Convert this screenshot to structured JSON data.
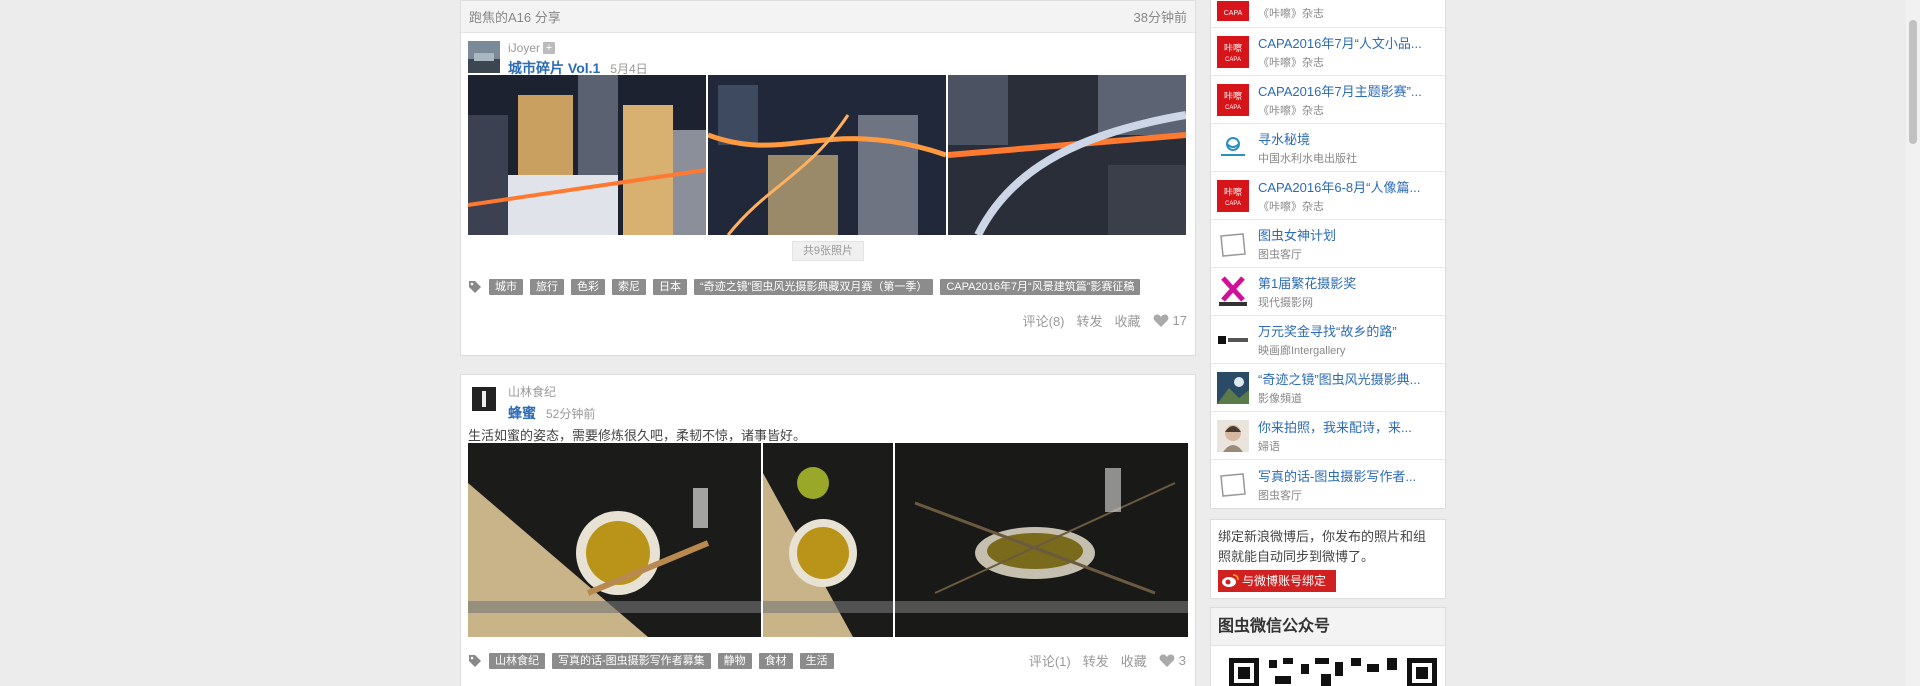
{
  "feed": {
    "post1": {
      "header_left": "跑焦的A16 分享",
      "header_right": "38分钟前",
      "author": "iJoyer",
      "title": "城市碎片 Vol.1",
      "date": "5月4日",
      "more_photos": "共9张照片",
      "tags": [
        "城市",
        "旅行",
        "色彩",
        "索尼",
        "日本",
        "“奇迹之镜”图虫风光摄影典藏双月赛（第一季）",
        "CAPA2016年7月“风景建筑篇”影赛征稿"
      ],
      "comments": "评论(8)",
      "repost": "转发",
      "favorite": "收藏",
      "likes": "17"
    },
    "post2": {
      "author": "山林食纪",
      "title": "蜂蜜",
      "date": "52分钟前",
      "description": "生活如蜜的姿态，需要修炼很久吧，柔韧不惊，诸事皆好。",
      "tags": [
        "山林食纪",
        "写真的话-图虫摄影写作者募集",
        "静物",
        "食材",
        "生活"
      ],
      "comments": "评论(1)",
      "repost": "转发",
      "favorite": "收藏",
      "likes": "3"
    }
  },
  "sidebar": {
    "events": [
      {
        "title": "",
        "sub": "《咔嚓》杂志",
        "logo": "capa-logo"
      },
      {
        "title": "CAPA2016年7月“人文小品...",
        "sub": "《咔嚓》杂志",
        "logo": "capa-logo"
      },
      {
        "title": "CAPA2016年7月主题影赛”...",
        "sub": "《咔嚓》杂志",
        "logo": "capa-logo"
      },
      {
        "title": "寻水秘境",
        "sub": "中国水利水电出版社",
        "logo": "waterpress-logo"
      },
      {
        "title": "CAPA2016年6-8月“人像篇...",
        "sub": "《咔嚓》杂志",
        "logo": "capa-logo"
      },
      {
        "title": "图虫女神计划",
        "sub": "图虫客厅",
        "logo": "placeholder-logo"
      },
      {
        "title": "第1届繁花摄影奖",
        "sub": "现代摄影网",
        "logo": "modern-photo-logo"
      },
      {
        "title": "万元奖金寻找“故乡的路”",
        "sub": "映画廊Intergallery",
        "logo": "intergallery-logo"
      },
      {
        "title": "“奇迹之镜”图虫风光摄影典...",
        "sub": "影像頻道",
        "logo": "landscape-logo"
      },
      {
        "title": "你来拍照，我来配诗，来...",
        "sub": "婦语",
        "logo": "portrait-logo"
      },
      {
        "title": "写真的话-图虫摄影写作者...",
        "sub": "图虫客厅",
        "logo": "placeholder-logo"
      }
    ],
    "weibo": {
      "text": "绑定新浪微博后，你发布的照片和组照就能自动同步到微博了。",
      "button": "与微博账号绑定"
    },
    "wechat": {
      "title": "图虫微信公众号"
    }
  },
  "colors": {
    "link": "#2c6bb5",
    "tag_bg": "#8c8c8c",
    "capa_red": "#d7141a",
    "weibo_red": "#d02020"
  }
}
